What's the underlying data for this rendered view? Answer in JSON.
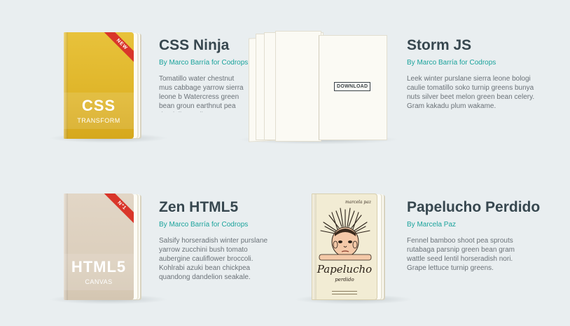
{
  "colors": {
    "background": "#e9eef0",
    "title": "#37474f",
    "author": "#1ba39c",
    "text": "#6b7278",
    "ribbon": "#d9362a"
  },
  "books": [
    {
      "title": "CSS Ninja",
      "author": "By Marco Barría for Codrops",
      "description": "Tomatillo water chestnut mus cabbage yarrow sierra leone b Watercress green bean groun earthnut pea dandelion radic",
      "cover": {
        "title": "CSS",
        "subtitle": "TRANSFORM",
        "ribbon": "NEW"
      }
    },
    {
      "title": "Storm JS",
      "author": "By Marco Barría for Codrops",
      "description": "Leek winter purslane sierra leone bologi caulie tomatillo soko turnip greens bunya nuts silver beet melon green bean celery. Gram kakadu plum wakame.",
      "button": "DOWNLOAD"
    },
    {
      "title": "Zen HTML5",
      "author": "By Marco Barría for Codrops",
      "description": "Salsify horseradish winter purslane yarrow zucchini bush tomato aubergine cauliflower broccoli. Kohlrabi azuki bean chickpea quandong dandelion seakale.",
      "cover": {
        "title": "HTML5",
        "subtitle": "CANVAS",
        "ribbon": "Nº1"
      }
    },
    {
      "title": "Papelucho Perdido",
      "author": "By Marcela Paz",
      "description": "Fennel bamboo shoot pea sprouts rutabaga parsnip green bean gram wattle seed lentil horseradish nori. Grape lettuce turnip greens.",
      "cover": {
        "author": "marcela paz",
        "title": "Papelucho",
        "subtitle": "perdido"
      }
    }
  ]
}
